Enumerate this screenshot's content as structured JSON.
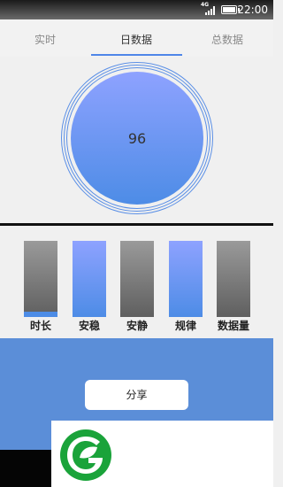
{
  "status_bar": {
    "network": "4G",
    "time": "22:00"
  },
  "tabs": [
    {
      "label": "实时",
      "active": false
    },
    {
      "label": "日数据",
      "active": true
    },
    {
      "label": "总数据",
      "active": false
    }
  ],
  "score": {
    "value": "96"
  },
  "metrics": [
    {
      "label": "时长",
      "style": "gray",
      "level": 0.07
    },
    {
      "label": "安稳",
      "style": "blue",
      "level": 1.0
    },
    {
      "label": "安静",
      "style": "gray",
      "level": 0
    },
    {
      "label": "规律",
      "style": "blue",
      "level": 1.0
    },
    {
      "label": "数据量",
      "style": "gray",
      "level": 0
    }
  ],
  "share": {
    "label": "分享"
  },
  "colors": {
    "accent": "#4d8ce6",
    "panel": "#5b8ed8",
    "logo_green": "#1aa33a"
  },
  "icons": {
    "logo": "leaf-logo-icon"
  }
}
